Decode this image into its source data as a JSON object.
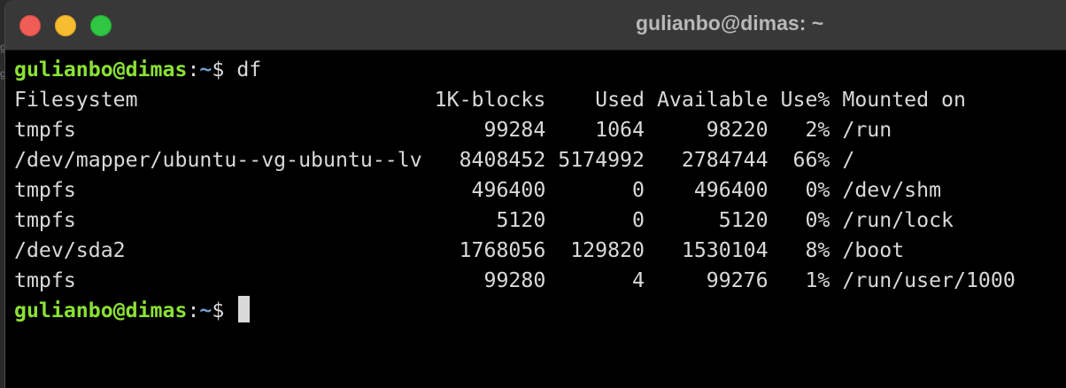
{
  "window": {
    "title": "gulianbo@dimas: ~"
  },
  "terminal": {
    "prompt": {
      "user_host": "gulianbo@dimas",
      "colon": ":",
      "path": "~",
      "symbol": "$ "
    },
    "command": "df",
    "df_header": {
      "filesystem": "Filesystem",
      "blocks": "1K-blocks",
      "used": "Used",
      "available": "Available",
      "use_pct": "Use%",
      "mounted_on": "Mounted on"
    },
    "df_rows": [
      {
        "filesystem": "tmpfs",
        "blocks": "99284",
        "used": "1064",
        "available": "98220",
        "use_pct": "2%",
        "mounted_on": "/run"
      },
      {
        "filesystem": "/dev/mapper/ubuntu--vg-ubuntu--lv",
        "blocks": "8408452",
        "used": "5174992",
        "available": "2784744",
        "use_pct": "66%",
        "mounted_on": "/"
      },
      {
        "filesystem": "tmpfs",
        "blocks": "496400",
        "used": "0",
        "available": "496400",
        "use_pct": "0%",
        "mounted_on": "/dev/shm"
      },
      {
        "filesystem": "tmpfs",
        "blocks": "5120",
        "used": "0",
        "available": "5120",
        "use_pct": "0%",
        "mounted_on": "/run/lock"
      },
      {
        "filesystem": "/dev/sda2",
        "blocks": "1768056",
        "used": "129820",
        "available": "1530104",
        "use_pct": "8%",
        "mounted_on": "/boot"
      },
      {
        "filesystem": "tmpfs",
        "blocks": "99280",
        "used": "4",
        "available": "99276",
        "use_pct": "1%",
        "mounted_on": "/run/user/1000"
      }
    ]
  },
  "colors": {
    "prompt_user": "#8ae234",
    "prompt_path": "#729fcf",
    "text": "#d9d9d9",
    "background": "#000000",
    "close": "#ee5e57",
    "minimize": "#f5bd2f",
    "zoom": "#2fc641"
  }
}
